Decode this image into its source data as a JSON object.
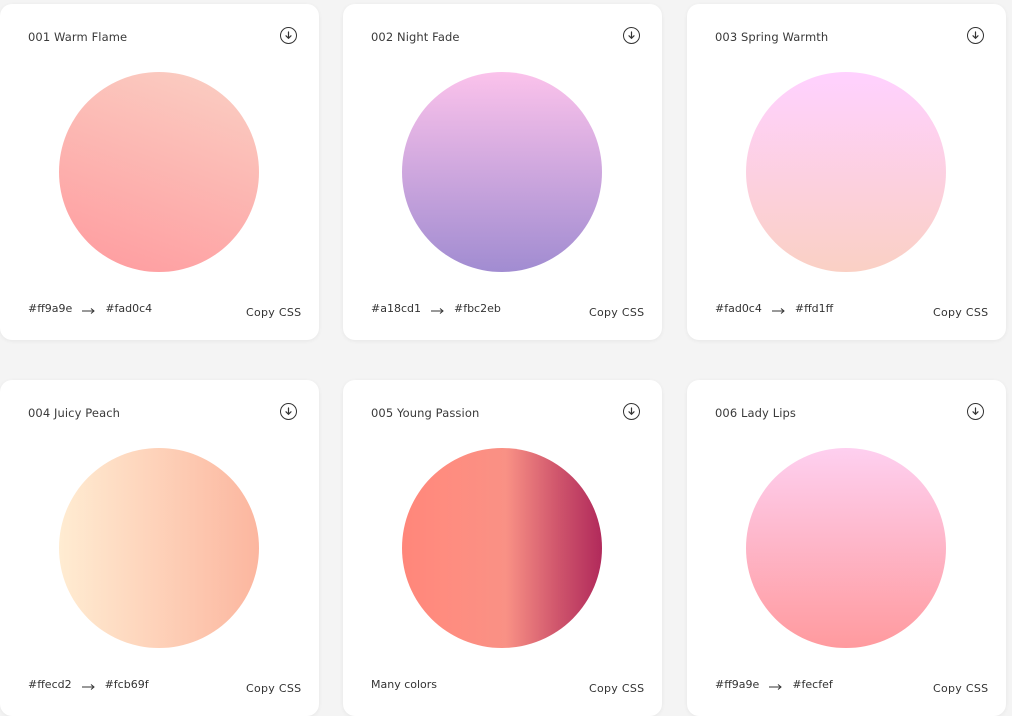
{
  "copy_label": "Copy CSS",
  "cards": [
    {
      "title": "001 Warm Flame",
      "from": "#ff9a9e",
      "to": "#fad0c4",
      "colors_text": "",
      "gradient": "linear-gradient(20deg, #ff9a9e 0%, #fad0c4 100%)"
    },
    {
      "title": "002 Night Fade",
      "from": "#a18cd1",
      "to": "#fbc2eb",
      "colors_text": "",
      "gradient": "linear-gradient(to top, #a18cd1 0%, #fbc2eb 100%)"
    },
    {
      "title": "003 Spring Warmth",
      "from": "#fad0c4",
      "to": "#ffd1ff",
      "colors_text": "",
      "gradient": "linear-gradient(to top, #fad0c4 0%, #ffd1ff 100%)"
    },
    {
      "title": "004 Juicy Peach",
      "from": "#ffecd2",
      "to": "#fcb69f",
      "colors_text": "",
      "gradient": "linear-gradient(to right, #ffecd2 0%, #fcb69f 100%)"
    },
    {
      "title": "005 Young Passion",
      "from": "",
      "to": "",
      "colors_text": "Many colors",
      "gradient": "linear-gradient(to right, #ff8177 0%, #ff867a 0%, #ff8c7f 21%, #f99185 52%, #cf556c 78%, #b12a5b 100%)"
    },
    {
      "title": "006 Lady Lips",
      "from": "#ff9a9e",
      "to": "#fecfef",
      "colors_text": "",
      "gradient": "linear-gradient(to top, #ff9a9e 0%, #fecfef 99%, #fecfef 100%)"
    }
  ]
}
